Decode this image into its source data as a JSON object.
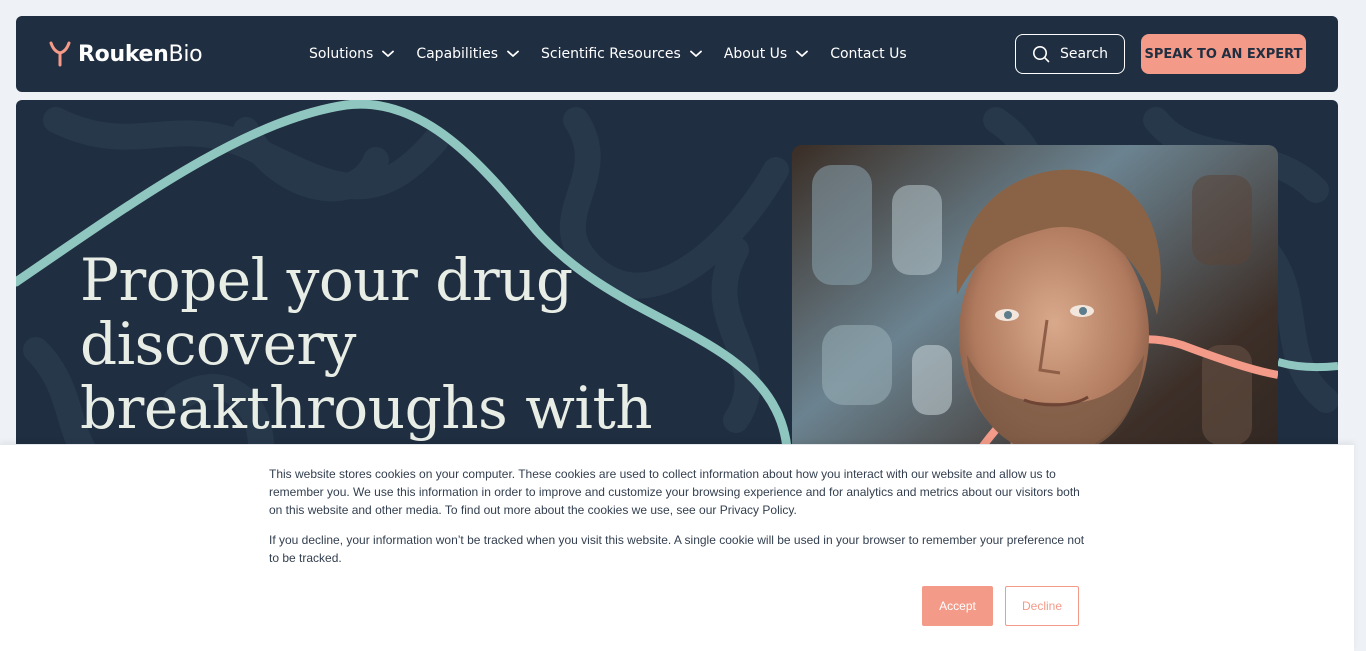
{
  "brand": {
    "logo_bold": "Rouken",
    "logo_light": "Bio",
    "colors": {
      "navy": "#1f2e40",
      "coral": "#f39a88",
      "teal": "#8fc7c0",
      "cream": "#e8ede6"
    }
  },
  "nav": {
    "items": [
      {
        "label": "Solutions",
        "has_dropdown": true
      },
      {
        "label": "Capabilities",
        "has_dropdown": true
      },
      {
        "label": "Scientific Resources",
        "has_dropdown": true
      },
      {
        "label": "About Us",
        "has_dropdown": true
      },
      {
        "label": "Contact Us",
        "has_dropdown": false
      }
    ],
    "search_label": "Search",
    "cta_label": "SPEAK TO AN EXPERT"
  },
  "hero": {
    "title": "Propel your drug discovery breakthroughs with",
    "image": "portrait-photo"
  },
  "cookie_banner": {
    "paragraph_1": "This website stores cookies on your computer. These cookies are used to collect information about how you interact with our website and allow us to remember you. We use this information in order to improve and customize your browsing experience and for analytics and metrics about our visitors both on this website and other media. To find out more about the cookies we use, see our Privacy Policy.",
    "paragraph_2": "If you decline, your information won’t be tracked when you visit this website. A single cookie will be used in your browser to remember your preference not to be tracked.",
    "accept_label": "Accept",
    "decline_label": "Decline"
  }
}
